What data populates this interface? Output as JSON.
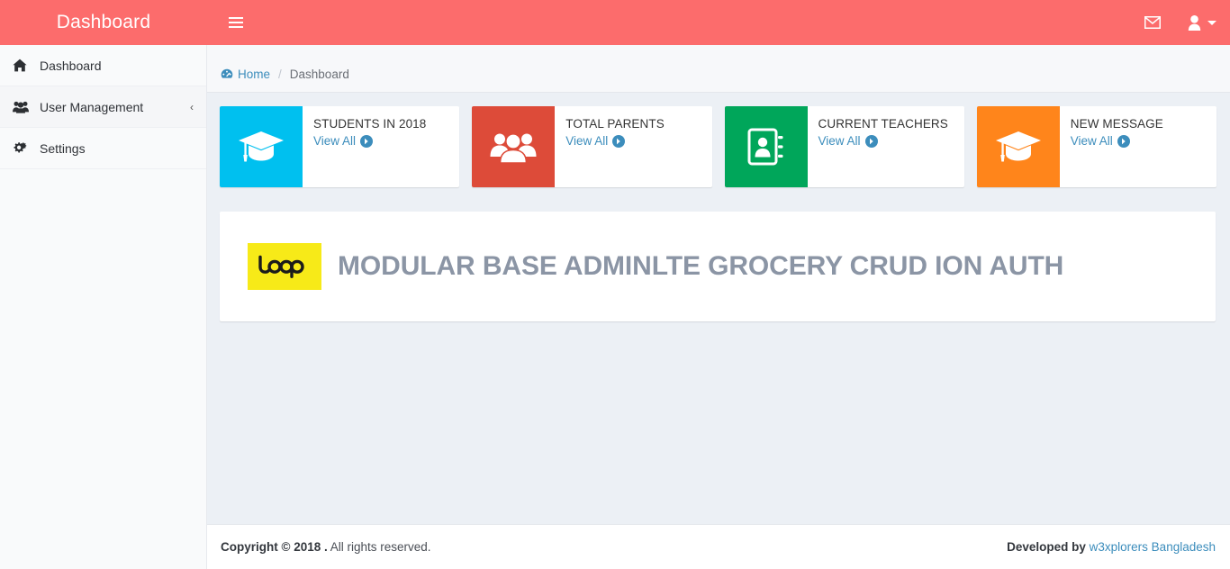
{
  "header": {
    "brand_title": "Dashboard",
    "toggle_icon": "hamburger-icon",
    "messages_icon": "envelope-icon",
    "user_icon": "user-icon",
    "caret_icon": "caret-down-icon"
  },
  "sidebar": {
    "items": [
      {
        "label": "Dashboard",
        "icon": "home-icon",
        "has_arrow": false
      },
      {
        "label": "User Management",
        "icon": "users-icon",
        "has_arrow": true,
        "arrow": "‹"
      },
      {
        "label": "Settings",
        "icon": "cogs-icon",
        "has_arrow": false
      }
    ]
  },
  "breadcrumb": {
    "icon": "tachometer-icon",
    "home_label": "Home",
    "separator": "/",
    "current_label": "Dashboard"
  },
  "info_boxes": [
    {
      "title": "STUDENTS IN 2018",
      "link_label": "View All",
      "icon": "graduation-cap-icon",
      "color": "#00c0ef",
      "color_class": "bg-aqua"
    },
    {
      "title": "TOTAL PARENTS",
      "link_label": "View All",
      "icon": "users-icon",
      "color": "#dd4b39",
      "color_class": "bg-red"
    },
    {
      "title": "CURRENT TEACHERS",
      "link_label": "View All",
      "icon": "address-book-icon",
      "color": "#00a65a",
      "color_class": "bg-green"
    },
    {
      "title": "NEW MESSAGE",
      "link_label": "View All",
      "icon": "graduation-cap-icon",
      "color": "#ff851b",
      "color_class": "bg-yellow"
    }
  ],
  "main_panel": {
    "logo_alt": "Logo",
    "logo_bg": "#f7ea18",
    "title": "MODULAR BASE ADMINLTE GROCERY CRUD ION AUTH"
  },
  "footer": {
    "copyright_strong": "Copyright © 2018 .",
    "copyright_rest": " All rights reserved.",
    "developed_strong": "Developed by ",
    "developed_link": "w3xplorers Bangladesh"
  },
  "colors": {
    "header_bg": "#fc6c6c",
    "sidebar_bg": "#f9fafb",
    "content_bg": "#ecf0f5",
    "link_blue": "#3c8dbc",
    "title_gray": "#8b95a5"
  }
}
